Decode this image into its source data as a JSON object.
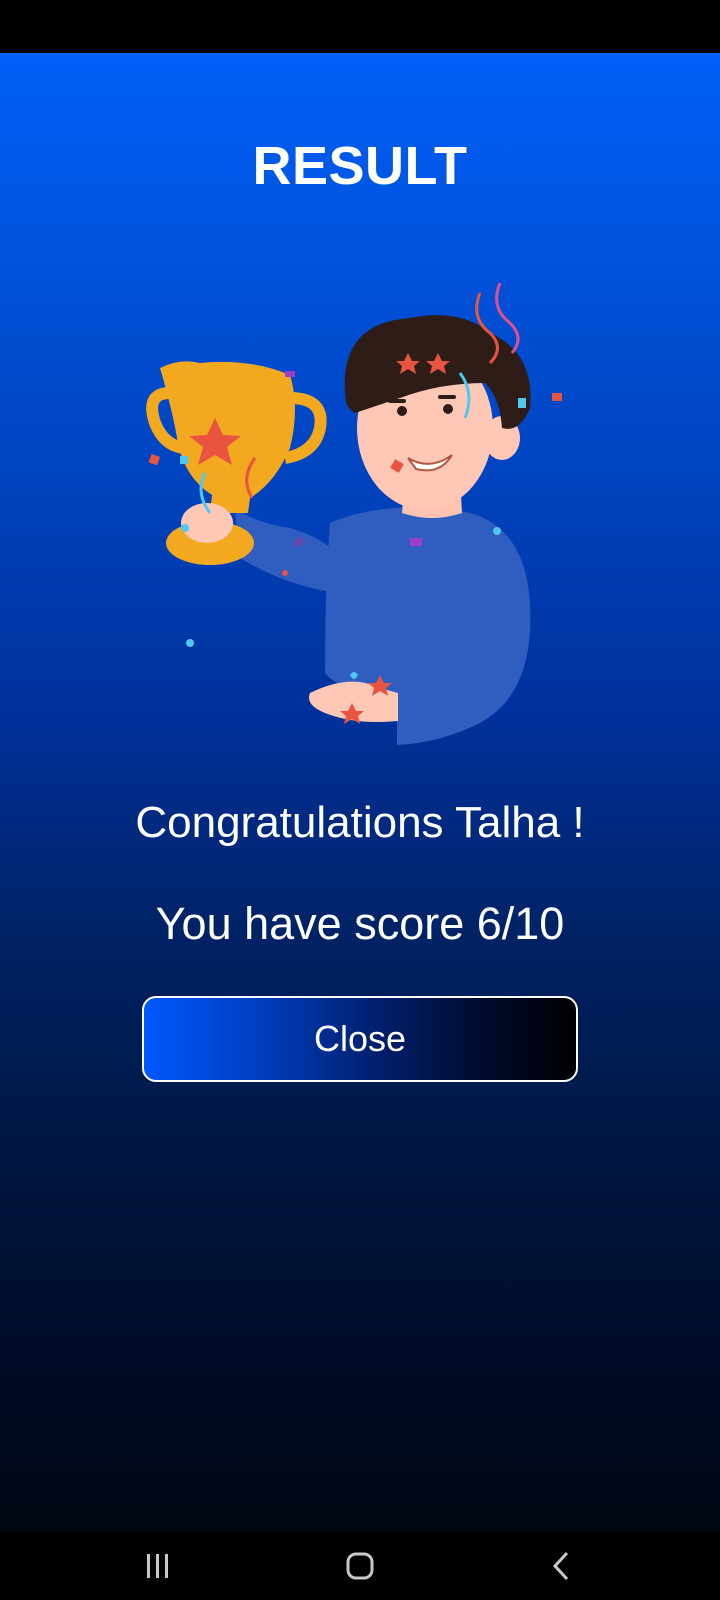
{
  "screen": {
    "title": "RESULT",
    "congrats_text": "Congratulations Talha !",
    "score_text": "You have score 6/10",
    "close_label": "Close",
    "illustration": "trophy-winner-illustration"
  },
  "nav": {
    "recents_icon": "recents-icon",
    "home_icon": "home-icon",
    "back_icon": "back-icon"
  },
  "colors": {
    "gradient_top": "#0060f8",
    "gradient_bottom": "#000612",
    "text": "#ffffff",
    "button_border": "#ffffff"
  }
}
